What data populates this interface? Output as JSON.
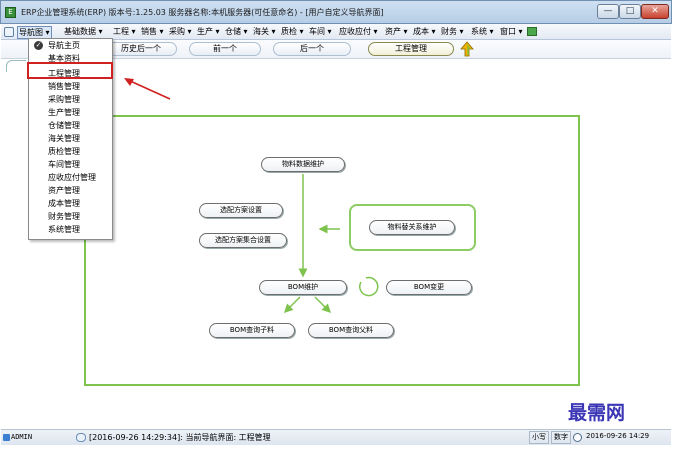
{
  "window": {
    "title": "ERP企业管理系统(ERP) 版本号:1.25.03  服务器名称:本机服务器(可任意命名) - [用户自定义导航界面]",
    "app_icon": "erp-app-icon",
    "controls": {
      "minimize": "—",
      "maximize": "□",
      "close": "✕"
    }
  },
  "menubar": {
    "items": [
      "导航图 ▾",
      "基础数据 ▾",
      "工程 ▾",
      "销售 ▾",
      "采购 ▾",
      "生产 ▾",
      "仓储 ▾",
      "海关 ▾",
      "质检 ▾",
      "车间 ▾",
      "应收应付 ▾",
      "资产 ▾",
      "成本 ▾",
      "财务 ▾",
      "系统 ▾",
      "窗口 ▾"
    ]
  },
  "toolbar": {
    "history_back": "历史后一个",
    "previous": "前一个",
    "next": "后一个",
    "current": "工程管理"
  },
  "dropdown": {
    "items": [
      "导航主页",
      "基本资料",
      "工程管理",
      "销售管理",
      "采购管理",
      "生产管理",
      "仓储管理",
      "海关管理",
      "质检管理",
      "车间管理",
      "应收应付管理",
      "资产管理",
      "成本管理",
      "财务管理",
      "系统管理"
    ],
    "checked_item": "导航主页",
    "highlighted_item": "工程管理"
  },
  "diagram": {
    "material_data": "物料数据维护",
    "option_setup": "选配方案设置",
    "option_set_setup": "选配方案集合设置",
    "material_relation": "物料替关系维护",
    "bom_maintain": "BOM维护",
    "bom_change": "BOM变更",
    "bom_query_child": "BOM查询子料",
    "bom_query_parent": "BOM查询父料"
  },
  "statusbar": {
    "user": "ADMIN",
    "message": "[2016-09-26 14:29:34]: 当前导航界面: 工程管理",
    "caps": "小写",
    "num": "数字",
    "datetime": "2016-09-26  14:29"
  },
  "watermark": "最需网",
  "colors": {
    "diagram_frame": "#7fc34f",
    "highlight": "#d02020",
    "watermark": "#3b36b5"
  }
}
